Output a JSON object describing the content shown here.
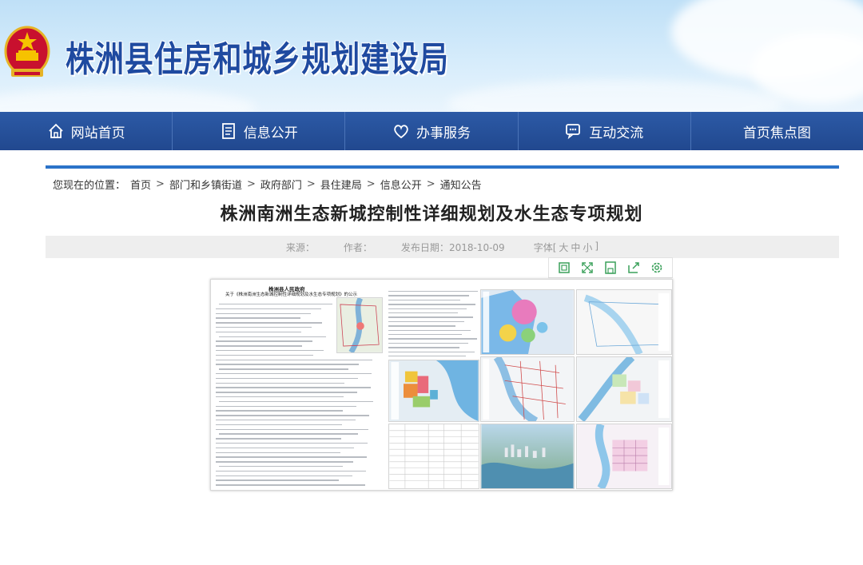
{
  "site": {
    "title": "株洲县住房和城乡规划建设局"
  },
  "nav": {
    "items": [
      {
        "label": "网站首页",
        "icon": "home-icon"
      },
      {
        "label": "信息公开",
        "icon": "document-icon"
      },
      {
        "label": "办事服务",
        "icon": "heart-icon"
      },
      {
        "label": "互动交流",
        "icon": "chat-icon"
      },
      {
        "label": "首页焦点图",
        "icon": ""
      }
    ]
  },
  "breadcrumb": {
    "prefix": "您现在的位置：",
    "items": [
      "首页",
      "部门和乡镇街道",
      "政府部门",
      "县住建局",
      "信息公开",
      "通知公告"
    ],
    "separator": ">"
  },
  "article": {
    "title": "株洲南洲生态新城控制性详细规划及水生态专项规划",
    "meta": {
      "source_label": "来源：",
      "author_label": "作者：",
      "date_label": "发布日期：",
      "date": "2018-10-09",
      "fontsize_label": "字体[",
      "fontsize_options": [
        "大",
        "中",
        "小"
      ],
      "fontsize_close": "]"
    },
    "doc_image": {
      "header_line1": "株洲县人民政府",
      "header_line2": "关于《株洲南洲生态新城控制性详细规划及水生态专项规划》的公示"
    }
  },
  "toolbar": {
    "tools": [
      "fit-icon",
      "fullscreen-icon",
      "save-icon",
      "share-icon",
      "settings-icon"
    ]
  },
  "colors": {
    "nav_bg": "#21488f",
    "accent": "#2b73c9",
    "title_blue": "#1f4aa0"
  }
}
